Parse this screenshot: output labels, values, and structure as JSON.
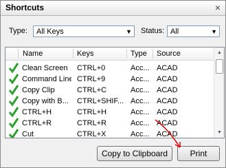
{
  "window": {
    "title": "Shortcuts",
    "close_glyph": "×"
  },
  "filters": {
    "type_label": "Type:",
    "type_value": "All Keys",
    "status_label": "Status:",
    "status_value": "All"
  },
  "table": {
    "headers": [
      "Name",
      "Keys",
      "Type",
      "Source"
    ],
    "rows": [
      {
        "name": "Clean Screen",
        "keys": "CTRL+0",
        "type": "Acc...",
        "source": "ACAD"
      },
      {
        "name": "Command Line",
        "keys": "CTRL+9",
        "type": "Acc...",
        "source": "ACAD"
      },
      {
        "name": "Copy Clip",
        "keys": "CTRL+C",
        "type": "Acc...",
        "source": "ACAD"
      },
      {
        "name": "Copy with B...",
        "keys": "CTRL+SHIF...",
        "type": "Acc...",
        "source": "ACAD"
      },
      {
        "name": "CTRL+H",
        "keys": "CTRL+H",
        "type": "Acc...",
        "source": "ACAD"
      },
      {
        "name": "CTRL+R",
        "keys": "CTRL+R",
        "type": "Acc...",
        "source": "ACAD"
      },
      {
        "name": "Cut",
        "keys": "CTRL+X",
        "type": "Acc...",
        "source": "ACAD"
      }
    ]
  },
  "buttons": {
    "copy": "Copy to Clipboard",
    "print": "Print"
  },
  "colors": {
    "check": "#2e9e2e",
    "annotation_arrow": "#e00000"
  },
  "icons": {
    "row_status": "check-icon",
    "dropdown": "chevron-down-icon"
  }
}
